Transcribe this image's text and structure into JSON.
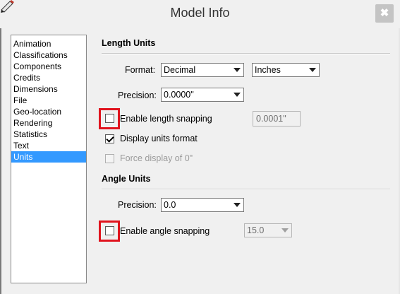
{
  "window": {
    "title": "Model Info",
    "close_glyph": "✖",
    "icon": "pencil-icon"
  },
  "sidebar": {
    "items": [
      {
        "label": "Animation",
        "selected": false
      },
      {
        "label": "Classifications",
        "selected": false
      },
      {
        "label": "Components",
        "selected": false
      },
      {
        "label": "Credits",
        "selected": false
      },
      {
        "label": "Dimensions",
        "selected": false
      },
      {
        "label": "File",
        "selected": false
      },
      {
        "label": "Geo-location",
        "selected": false
      },
      {
        "label": "Rendering",
        "selected": false
      },
      {
        "label": "Statistics",
        "selected": false
      },
      {
        "label": "Text",
        "selected": false
      },
      {
        "label": "Units",
        "selected": true
      }
    ]
  },
  "length_units": {
    "title": "Length Units",
    "format_label": "Format:",
    "format_value": "Decimal",
    "unit_value": "Inches",
    "precision_label": "Precision:",
    "precision_value": "0.0000\"",
    "snapping_label": "Enable length snapping",
    "snapping_checked": false,
    "snapping_value": "0.0001\"",
    "display_units_label": "Display units format",
    "display_units_checked": true,
    "force_display_label": "Force display of 0\"",
    "force_display_checked": false
  },
  "angle_units": {
    "title": "Angle Units",
    "precision_label": "Precision:",
    "precision_value": "0.0",
    "snapping_label": "Enable angle snapping",
    "snapping_checked": false,
    "snapping_value": "15.0"
  },
  "colors": {
    "highlight": "#e0141e",
    "selection": "#3399ff"
  }
}
